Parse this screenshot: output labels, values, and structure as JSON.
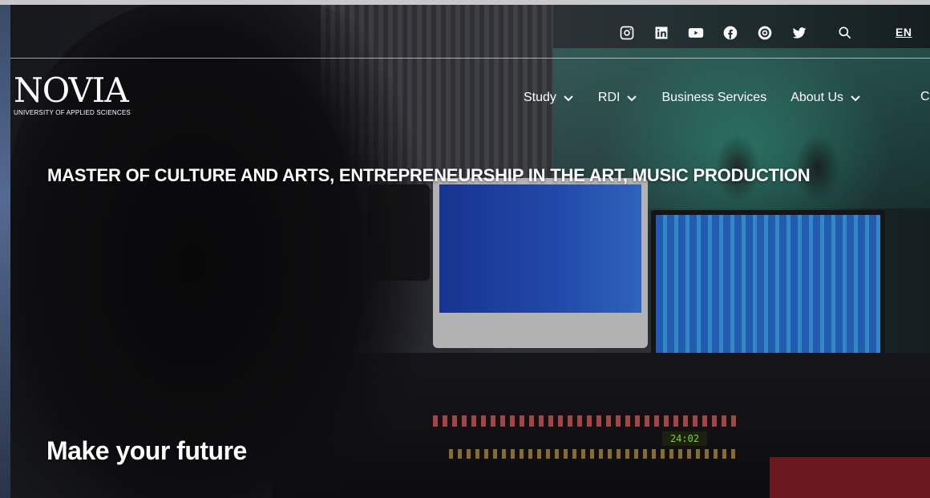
{
  "header": {
    "social": [
      {
        "icon": "instagram-icon"
      },
      {
        "icon": "linkedin-icon"
      },
      {
        "icon": "youtube-icon"
      },
      {
        "icon": "facebook-icon"
      },
      {
        "icon": "issuu-icon"
      },
      {
        "icon": "twitter-icon"
      },
      {
        "icon": "search-icon"
      }
    ],
    "language": "EN"
  },
  "logo": {
    "wordmark": "NOVIA",
    "subtitle": "UNIVERSITY OF APPLIED SCIENCES"
  },
  "nav": {
    "items": [
      {
        "label": "Study",
        "has_dropdown": true
      },
      {
        "label": "RDI",
        "has_dropdown": true
      },
      {
        "label": "Business Services",
        "has_dropdown": false
      },
      {
        "label": "About Us",
        "has_dropdown": true
      }
    ],
    "cut_item": "C"
  },
  "hero": {
    "headline": "MASTER OF CULTURE AND ARTS, ENTREPRENEURSHIP IN THE ART, MUSIC PRODUCTION",
    "tagline": "Make your future",
    "display_readout": "24:02"
  }
}
